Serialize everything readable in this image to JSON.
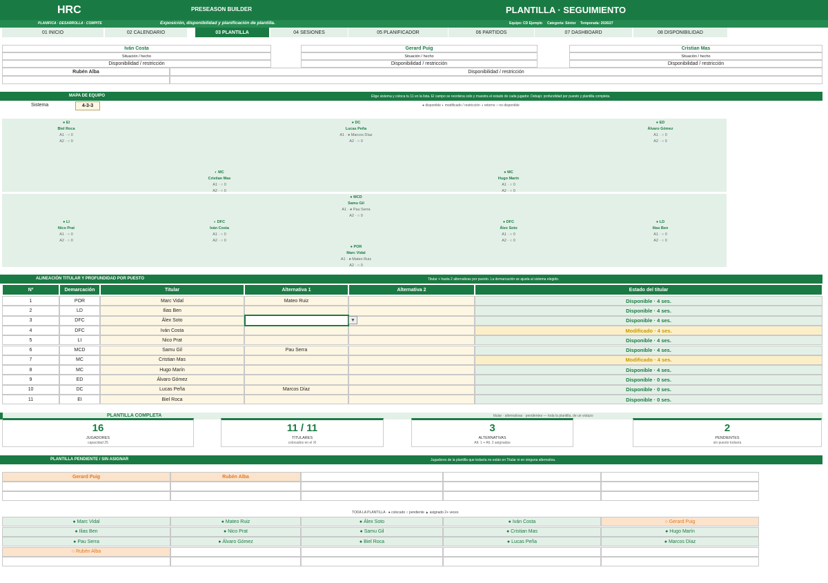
{
  "header": {
    "brand": "HRC",
    "builder": "PRESEASON BUILDER",
    "title": "PLANTILLA · SEGUIMIENTO",
    "sub_left": "PLANIFICA · DESARROLLA · COMPITE",
    "sub_mid": "Exposición, disponibilidad y planificación de plantilla.",
    "team": "Equipo: CD Ejemplo",
    "category": "Categoría: Sénior",
    "season": "Temporada: 2026/27"
  },
  "tabs": [
    "01 INICIO",
    "02 CALENDARIO",
    "03 PLANTILLA",
    "04 SESIONES",
    "05 PLANIFICADOR",
    "06 PARTIDOS",
    "07 DASHBOARD",
    "08 DISPONIBILIDAD"
  ],
  "cards": [
    {
      "name": "Iván Costa",
      "situation": "Situación / hecho",
      "avail": "Disponibilidad / restricción"
    },
    {
      "name": "Gerard Puig",
      "situation": "Situación / hecho",
      "avail": "Disponibilidad / restricción"
    },
    {
      "name": "Cristian Mas",
      "situation": "Situación / hecho",
      "avail": "Disponibilidad / restricción"
    }
  ],
  "card4": {
    "name": "Rubén Alba",
    "avail": "Disponibilidad / restricción"
  },
  "map": {
    "title": "MAPA DE EQUIPO",
    "desc": "Elige sistema y coloca tu 11 en la lista. El campo se reordena solo y muestra el estado de cada jugador. Debajo: profundidad por puesto y plantilla completa.",
    "system_label": "Sistema",
    "system_value": "4-3-3",
    "legend": "● disponible   ◐ modificado / restricción   ◑ retorno   ○ no disponible"
  },
  "pitch": [
    {
      "role": "● EI",
      "name": "Biel Roca",
      "a1": "A1 · ○ 0",
      "a2": "A2 · ○ 0"
    },
    {
      "role": "● DC",
      "name": "Lucas Peña",
      "a1": "A1 · ● Marcos Díaz",
      "a2": "A2 · ○ 0"
    },
    {
      "role": "● ED",
      "name": "Álvaro Gómez",
      "a1": "A1 · ○ 0",
      "a2": "A2 · ○ 0"
    },
    {
      "role": "◐ MC",
      "name": "Cristian Mas",
      "a1": "A1 · ○ 0",
      "a2": "A2 · ○ 0"
    },
    {
      "role": "● MC",
      "name": "Hugo Marín",
      "a1": "A1 · ○ 0",
      "a2": "A2 · ○ 0"
    },
    {
      "role": "● MCD",
      "name": "Samu Gil",
      "a1": "A1 · ● Pau Serra",
      "a2": "A2 · ○ 0"
    },
    {
      "role": "● LI",
      "name": "Nico Prat",
      "a1": "A1 · ○ 0",
      "a2": "A2 · ○ 0"
    },
    {
      "role": "◐ DFC",
      "name": "Iván Costa",
      "a1": "A1 · ○ 0",
      "a2": "A2 · ○ 0"
    },
    {
      "role": "● DFC",
      "name": "Álex Soto",
      "a1": "A1 · ○ 0",
      "a2": "A2 · ○ 0"
    },
    {
      "role": "● LD",
      "name": "Ilias Ben",
      "a1": "A1 · ○ 0",
      "a2": "A2 · ○ 0"
    },
    {
      "role": "● POR",
      "name": "Marc Vidal",
      "a1": "A1 · ● Mateo Ruiz",
      "a2": "A2 · ○ 0"
    }
  ],
  "lineup": {
    "title": "ALINEACIÓN TITULAR Y PROFUNDIDAD POR PUESTO",
    "desc": "Titular + hasta 2 alternativas por puesto. La demarcación se ajusta al sistema elegido.",
    "cols": [
      "Nº",
      "Demarcación",
      "Titular",
      "Alternativa 1",
      "Alternativa 2",
      "Estado del titular"
    ],
    "rows": [
      {
        "n": "1",
        "pos": "POR",
        "tit": "Marc Vidal",
        "a1": "Mateo Ruiz",
        "a2": "",
        "st": "Disponible  ·  4 ses.",
        "mod": false
      },
      {
        "n": "2",
        "pos": "LD",
        "tit": "Ilias Ben",
        "a1": "",
        "a2": "",
        "st": "Disponible  ·  4 ses.",
        "mod": false
      },
      {
        "n": "3",
        "pos": "DFC",
        "tit": "Álex Soto",
        "a1": "",
        "a2": "",
        "st": "Disponible  ·  4 ses.",
        "mod": false
      },
      {
        "n": "4",
        "pos": "DFC",
        "tit": "Iván Costa",
        "a1": "",
        "a2": "",
        "st": "Modificado  ·  4 ses.",
        "mod": true
      },
      {
        "n": "5",
        "pos": "LI",
        "tit": "Nico Prat",
        "a1": "",
        "a2": "",
        "st": "Disponible  ·  4 ses.",
        "mod": false
      },
      {
        "n": "6",
        "pos": "MCD",
        "tit": "Samu Gil",
        "a1": "Pau Serra",
        "a2": "",
        "st": "Disponible  ·  4 ses.",
        "mod": false
      },
      {
        "n": "7",
        "pos": "MC",
        "tit": "Cristian Mas",
        "a1": "",
        "a2": "",
        "st": "Modificado  ·  4 ses.",
        "mod": true
      },
      {
        "n": "8",
        "pos": "MC",
        "tit": "Hugo Marín",
        "a1": "",
        "a2": "",
        "st": "Disponible  ·  4 ses.",
        "mod": false
      },
      {
        "n": "9",
        "pos": "ED",
        "tit": "Álvaro Gómez",
        "a1": "",
        "a2": "",
        "st": "Disponible  ·  0 ses.",
        "mod": false
      },
      {
        "n": "10",
        "pos": "DC",
        "tit": "Lucas Peña",
        "a1": "Marcos Díaz",
        "a2": "",
        "st": "Disponible  ·  0 ses.",
        "mod": false
      },
      {
        "n": "11",
        "pos": "EI",
        "tit": "Biel Roca",
        "a1": "",
        "a2": "",
        "st": "Disponible  ·  0 ses.",
        "mod": false
      }
    ]
  },
  "squad": {
    "title": "PLANTILLA COMPLETA",
    "desc": "titular · alternativas · pendientes — toda la plantilla, de un vistazo",
    "kpis": [
      {
        "value": "16",
        "label": "JUGADORES",
        "sub": "capacidad 25"
      },
      {
        "value": "11 / 11",
        "label": "TITULARES",
        "sub": "colocados en el XI"
      },
      {
        "value": "3",
        "label": "ALTERNATIVAS",
        "sub": "Alt. 1 + Alt. 2 asignadas"
      },
      {
        "value": "2",
        "label": "PENDIENTES",
        "sub": "sin puesto todavía"
      }
    ]
  },
  "pending": {
    "title": "PLANTILLA PENDIENTE / SIN ASIGNAR",
    "desc": "Jugadores de la plantilla que todavía no están en Titular ni en ninguna alternativa.",
    "players": [
      "Gerard Puig",
      "Rubén Alba"
    ]
  },
  "all": {
    "legend": "TODA LA PLANTILLA  ·  ● colocado  ○ pendiente  ▲ asignado 2+ veces",
    "players": [
      {
        "n": "● Marc Vidal",
        "p": false
      },
      {
        "n": "● Mateo Ruiz",
        "p": false
      },
      {
        "n": "● Álex Soto",
        "p": false
      },
      {
        "n": "● Iván Costa",
        "p": false
      },
      {
        "n": "○ Gerard Puig",
        "p": true
      },
      {
        "n": "● Ilias Ben",
        "p": false
      },
      {
        "n": "● Nico Prat",
        "p": false
      },
      {
        "n": "● Samu Gil",
        "p": false
      },
      {
        "n": "● Cristian Mas",
        "p": false
      },
      {
        "n": "● Hugo Marín",
        "p": false
      },
      {
        "n": "● Pau Serra",
        "p": false
      },
      {
        "n": "● Álvaro Gómez",
        "p": false
      },
      {
        "n": "● Biel Roca",
        "p": false
      },
      {
        "n": "● Lucas Peña",
        "p": false
      },
      {
        "n": "● Marcos Díaz",
        "p": false
      },
      {
        "n": "○ Rubén Alba",
        "p": true
      }
    ]
  }
}
